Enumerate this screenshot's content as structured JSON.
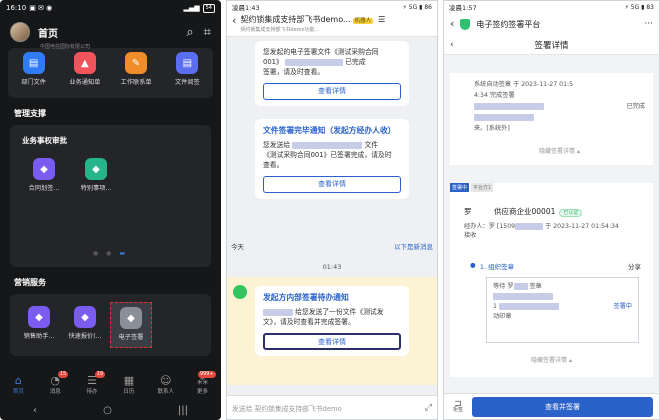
{
  "p1": {
    "status": {
      "time": "16:10",
      "battery": "54"
    },
    "header": {
      "title": "首页",
      "subtitle": "中国电信国际有限公司"
    },
    "top_apps": [
      {
        "label": "部门文件",
        "color": "#2f7cf5",
        "icon": "▤"
      },
      {
        "label": "业务通知单",
        "color": "#f0535c",
        "icon": "▲"
      },
      {
        "label": "工作联系单",
        "color": "#f08c2a",
        "icon": "✎"
      },
      {
        "label": "文件阅签",
        "color": "#5b6ef0",
        "icon": "▤"
      }
    ],
    "section_manage": "管理支撑",
    "card_title": "业务事权审批",
    "manage_apps": [
      {
        "label": "合同划签...",
        "color": "#7a5cf0",
        "icon": "◆"
      },
      {
        "label": "特别事项...",
        "color": "#26b48a",
        "icon": "◆"
      }
    ],
    "section_market": "营销服务",
    "market_apps": [
      {
        "label": "销售助手...",
        "color": "#7a5cf0",
        "icon": "◆"
      },
      {
        "label": "快速报价(...",
        "color": "#7a5cf0",
        "icon": "◆"
      },
      {
        "label": "电子签署",
        "color": "#8a8f99",
        "icon": "◆"
      }
    ],
    "tabs": [
      {
        "label": "首页",
        "icon": "⌂",
        "badge": ""
      },
      {
        "label": "消息",
        "icon": "◔",
        "badge": "15"
      },
      {
        "label": "待办",
        "icon": "☰",
        "badge": "19"
      },
      {
        "label": "日历",
        "icon": "▦",
        "badge": ""
      },
      {
        "label": "联系人",
        "icon": "☺",
        "badge": ""
      },
      {
        "label": "更多",
        "icon": "⁂",
        "badge": "999+"
      }
    ],
    "nav": {
      "back": "‹",
      "home": "○",
      "recent": "|||"
    }
  },
  "p2": {
    "status": {
      "time": "凌晨1:43",
      "right": "⚡ 5G ▮ 86"
    },
    "header": {
      "title": "契约锁集成支持部飞书demo...",
      "badge": "机器人",
      "subtitle": "契约锁集成支持部飞书demo功能..."
    },
    "msg1": {
      "line1": "您发起的电子签署文件《测试采购合同",
      "line2a": "001》",
      "line2b": "已完成",
      "line3": "签署，请及时查看。",
      "btn": "查看详情"
    },
    "msg2": {
      "title": "文件签署完毕通知（发起方经办人收）",
      "line1a": "您发送给",
      "line1b": "文件",
      "line2": "《测试采购合同001》已签署完成，请及时",
      "line3": "查看。",
      "btn": "查看详情"
    },
    "today": "今天",
    "new_msgs": "以下是新消息",
    "time_divider": "01:43",
    "msg3": {
      "title": "发起方内部签署待办通知",
      "line1": "给您发送了一份文件《测试发",
      "line2": "文》，请及时查看并完成签署。",
      "btn": "查看详情"
    },
    "input_placeholder": "发送给 契约锁集成支持部飞书demo",
    "expand_icon": "⤢"
  },
  "p3": {
    "status": {
      "time": "凌晨1:57",
      "right": "⚡ 5G ▮ 83"
    },
    "app_title": "电子签约签署平台",
    "page_title": "签署详情",
    "block1": {
      "line1": "系统自动签章 于 2023-11-27 01:5",
      "line2": "4:34 完成签署",
      "line3": "",
      "done": "已完成",
      "line4": "来。[系统外]",
      "hide": "隐藏签署详情"
    },
    "tags": [
      "签署中",
      "平台方1"
    ],
    "company": {
      "name": "罗　　　供应商企业00001",
      "ok": "已认证",
      "handler_label": "经办人：",
      "handler": "罗  [1509",
      "sent": "于 2023-11-27 01:54:34",
      "recv": "接收"
    },
    "org": {
      "label": "1. 组织签章",
      "share": "分享",
      "waiting": "等待",
      "sign": "签章",
      "org": "罗",
      "status": "签署中",
      "id": "1",
      "seal": "签章",
      "stamp": "动印章",
      "hide": "隐藏签署详情"
    },
    "bottom": {
      "small_label": "拒签",
      "button": "查看并签署"
    }
  }
}
